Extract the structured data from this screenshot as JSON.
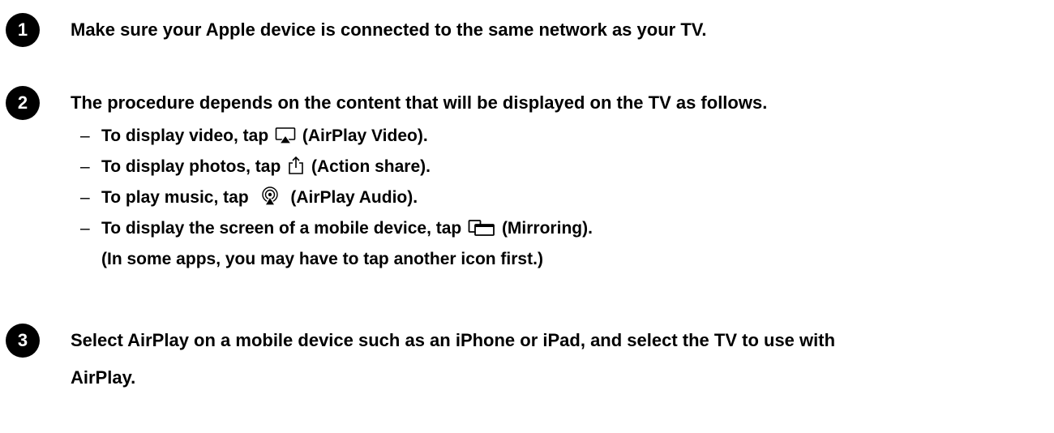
{
  "steps": [
    {
      "number": "1",
      "text": "Make sure your Apple device is connected to the same network as your TV."
    },
    {
      "number": "2",
      "text": "The procedure depends on the content that will be displayed on the TV as follows.",
      "items": [
        {
          "dash": "–",
          "before": "To display video, tap",
          "icon": "airplay-video-icon",
          "after": "(AirPlay Video)."
        },
        {
          "dash": "–",
          "before": "To display photos, tap",
          "icon": "action-share-icon",
          "after": "(Action share)."
        },
        {
          "dash": "–",
          "before": "To play music, tap",
          "icon": "airplay-audio-icon",
          "after": "(AirPlay Audio)."
        },
        {
          "dash": "–",
          "before": "To display the screen of a mobile device, tap",
          "icon": "mirroring-icon",
          "after": "(Mirroring)."
        }
      ],
      "note": "(In some apps, you may have to tap another icon first.)"
    },
    {
      "number": "3",
      "text_line1": "Select AirPlay on a mobile device such as an iPhone or iPad, and select the TV to use with",
      "text_line2": "AirPlay."
    }
  ]
}
